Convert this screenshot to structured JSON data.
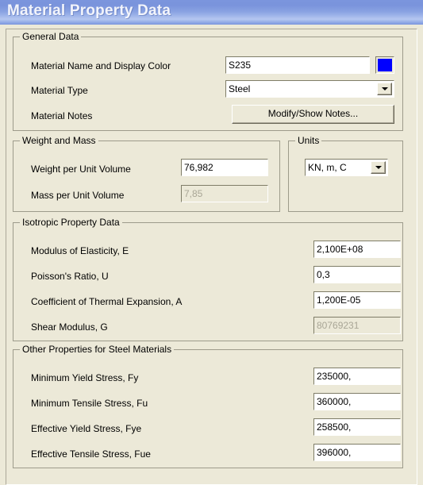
{
  "window": {
    "title": "Material Property Data"
  },
  "general": {
    "title": "General Data",
    "name_label": "Material Name and Display Color",
    "name_value": "S235",
    "display_color": "#0000FF",
    "type_label": "Material Type",
    "type_value": "Steel",
    "notes_label": "Material Notes",
    "notes_button": "Modify/Show Notes..."
  },
  "weight_mass": {
    "title": "Weight and Mass",
    "weight_label": "Weight per Unit Volume",
    "weight_value": "76,982",
    "mass_label": "Mass per Unit Volume",
    "mass_value": "7,85"
  },
  "units": {
    "title": "Units",
    "value": "KN, m, C"
  },
  "isotropic": {
    "title": "Isotropic Property Data",
    "rows": [
      {
        "label": "Modulus of Elasticity,  E",
        "value": "2,100E+08",
        "disabled": false
      },
      {
        "label": "Poisson's Ratio,  U",
        "value": "0,3",
        "disabled": false
      },
      {
        "label": "Coefficient of Thermal Expansion,  A",
        "value": "1,200E-05",
        "disabled": false
      },
      {
        "label": "Shear Modulus,  G",
        "value": "80769231",
        "disabled": true
      }
    ]
  },
  "other_properties": {
    "title": "Other Properties for Steel Materials",
    "rows": [
      {
        "label": "Minimum Yield Stress, Fy",
        "value": "235000,"
      },
      {
        "label": "Minimum Tensile Stress, Fu",
        "value": "360000,"
      },
      {
        "label": "Effective Yield Stress, Fye",
        "value": "258500,"
      },
      {
        "label": "Effective Tensile Stress, Fue",
        "value": "396000,"
      }
    ]
  }
}
